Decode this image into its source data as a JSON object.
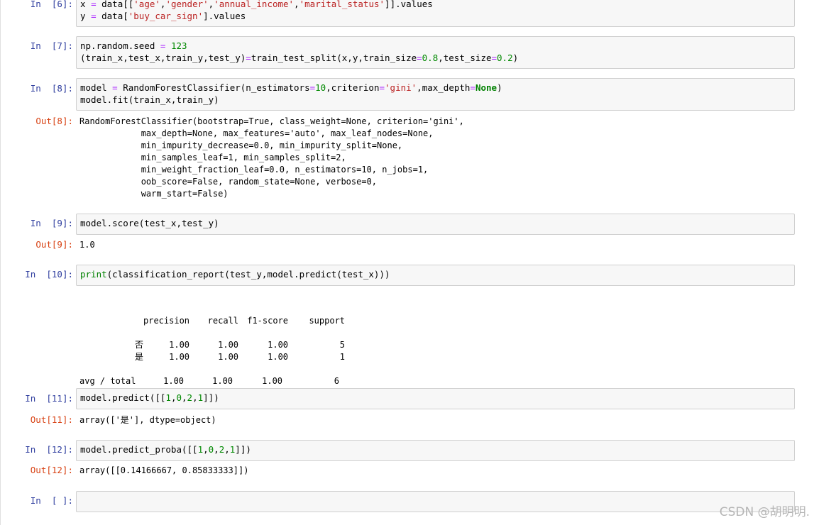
{
  "cells": [
    {
      "prompt": "In  [6]:",
      "lines": [
        [
          {
            "t": "x ",
            "c": ""
          },
          {
            "t": "=",
            "c": "op"
          },
          {
            "t": " data[[",
            "c": ""
          },
          {
            "t": "'age'",
            "c": "str"
          },
          {
            "t": ",",
            "c": ""
          },
          {
            "t": "'gender'",
            "c": "str"
          },
          {
            "t": ",",
            "c": ""
          },
          {
            "t": "'annual_income'",
            "c": "str"
          },
          {
            "t": ",",
            "c": ""
          },
          {
            "t": "'marital_status'",
            "c": "str"
          },
          {
            "t": "]].values",
            "c": ""
          }
        ],
        [
          {
            "t": "y ",
            "c": ""
          },
          {
            "t": "=",
            "c": "op"
          },
          {
            "t": " data[",
            "c": ""
          },
          {
            "t": "'buy_car_sign'",
            "c": "str"
          },
          {
            "t": "].values",
            "c": ""
          }
        ]
      ]
    },
    {
      "prompt": "In  [7]:",
      "lines": [
        [
          {
            "t": "np.random.seed ",
            "c": ""
          },
          {
            "t": "=",
            "c": "op"
          },
          {
            "t": " ",
            "c": ""
          },
          {
            "t": "123",
            "c": "num"
          }
        ],
        [
          {
            "t": "(train_x,test_x,train_y,test_y)",
            "c": ""
          },
          {
            "t": "=",
            "c": "op"
          },
          {
            "t": "train_test_split(x,y,train_size",
            "c": ""
          },
          {
            "t": "=",
            "c": "op"
          },
          {
            "t": "0.8",
            "c": "num"
          },
          {
            "t": ",test_size",
            "c": ""
          },
          {
            "t": "=",
            "c": "op"
          },
          {
            "t": "0.2",
            "c": "num"
          },
          {
            "t": ")",
            "c": ""
          }
        ]
      ]
    },
    {
      "prompt": "In  [8]:",
      "lines": [
        [
          {
            "t": "model ",
            "c": ""
          },
          {
            "t": "=",
            "c": "op"
          },
          {
            "t": " RandomForestClassifier(n_estimators",
            "c": ""
          },
          {
            "t": "=",
            "c": "op"
          },
          {
            "t": "10",
            "c": "num"
          },
          {
            "t": ",criterion",
            "c": ""
          },
          {
            "t": "=",
            "c": "op"
          },
          {
            "t": "'gini'",
            "c": "str"
          },
          {
            "t": ",max_depth",
            "c": ""
          },
          {
            "t": "=",
            "c": "op"
          },
          {
            "t": "None",
            "c": "kw"
          },
          {
            "t": ")",
            "c": ""
          }
        ],
        [
          {
            "t": "model.fit(train_x,train_y)",
            "c": ""
          }
        ]
      ],
      "out_prompt": "Out[8]:",
      "output": "RandomForestClassifier(bootstrap=True, class_weight=None, criterion='gini',\n            max_depth=None, max_features='auto', max_leaf_nodes=None,\n            min_impurity_decrease=0.0, min_impurity_split=None,\n            min_samples_leaf=1, min_samples_split=2,\n            min_weight_fraction_leaf=0.0, n_estimators=10, n_jobs=1,\n            oob_score=False, random_state=None, verbose=0,\n            warm_start=False)"
    },
    {
      "prompt": "In  [9]:",
      "lines": [
        [
          {
            "t": "model.score(test_x,test_y)",
            "c": ""
          }
        ]
      ],
      "out_prompt": "Out[9]:",
      "output": "1.0"
    },
    {
      "prompt": "In  [10]:",
      "lines": [
        [
          {
            "t": "print",
            "c": "bi"
          },
          {
            "t": "(classification_report(test_y,model.predict(test_x)))",
            "c": ""
          }
        ]
      ],
      "report": {
        "headers": [
          "",
          "precision",
          "recall",
          "f1-score",
          "support"
        ],
        "rows": [
          [
            "否",
            "1.00",
            "1.00",
            "1.00",
            "5"
          ],
          [
            "是",
            "1.00",
            "1.00",
            "1.00",
            "1"
          ]
        ],
        "total": [
          "avg / total",
          "1.00",
          "1.00",
          "1.00",
          "6"
        ]
      }
    },
    {
      "prompt": "In  [11]:",
      "lines": [
        [
          {
            "t": "model.predict([[",
            "c": ""
          },
          {
            "t": "1",
            "c": "num"
          },
          {
            "t": ",",
            "c": ""
          },
          {
            "t": "0",
            "c": "num"
          },
          {
            "t": ",",
            "c": ""
          },
          {
            "t": "2",
            "c": "num"
          },
          {
            "t": ",",
            "c": ""
          },
          {
            "t": "1",
            "c": "num"
          },
          {
            "t": "]])",
            "c": ""
          }
        ]
      ],
      "out_prompt": "Out[11]:",
      "output": "array(['是'], dtype=object)"
    },
    {
      "prompt": "In  [12]:",
      "lines": [
        [
          {
            "t": "model.predict_proba([[",
            "c": ""
          },
          {
            "t": "1",
            "c": "num"
          },
          {
            "t": ",",
            "c": ""
          },
          {
            "t": "0",
            "c": "num"
          },
          {
            "t": ",",
            "c": ""
          },
          {
            "t": "2",
            "c": "num"
          },
          {
            "t": ",",
            "c": ""
          },
          {
            "t": "1",
            "c": "num"
          },
          {
            "t": "]])",
            "c": ""
          }
        ]
      ],
      "out_prompt": "Out[12]:",
      "output": "array([[0.14166667, 0.85833333]])"
    },
    {
      "prompt": "In  [ ]:",
      "lines": [
        [
          {
            "t": "",
            "c": ""
          }
        ]
      ]
    }
  ],
  "watermark": "CSDN @胡明明."
}
